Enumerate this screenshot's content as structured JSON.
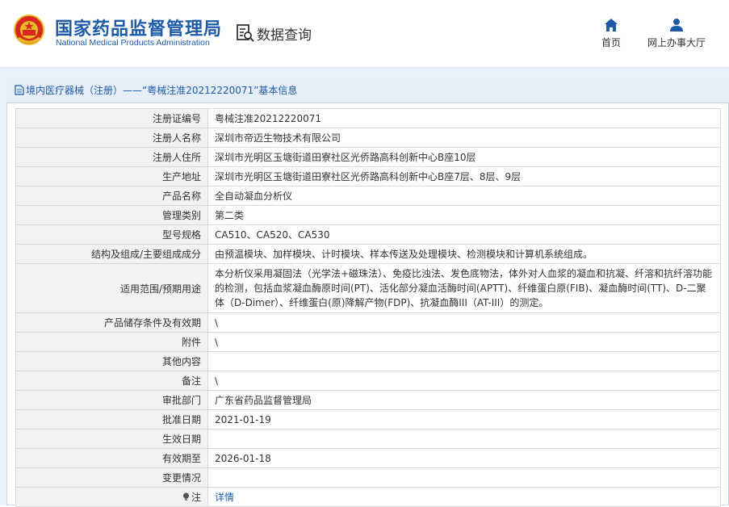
{
  "header": {
    "org_cn": "国家药品监督管理局",
    "org_en": "National Medical Products Administration",
    "query_label": "数据查询",
    "nav": [
      {
        "label": "首页",
        "icon": "home-icon"
      },
      {
        "label": "网上办事大厅",
        "icon": "user-icon"
      }
    ]
  },
  "breadcrumb": "境内医疗器械（注册）——“粤械注准20212220071”基本信息",
  "rows": [
    {
      "key": "注册证编号",
      "value": "粤械注准20212220071"
    },
    {
      "key": "注册人名称",
      "value": "深圳市帝迈生物技术有限公司"
    },
    {
      "key": "注册人住所",
      "value": "深圳市光明区玉塘街道田寮社区光侨路高科创新中心B座10层"
    },
    {
      "key": "生产地址",
      "value": "深圳市光明区玉塘街道田寮社区光侨路高科创新中心B座7层、8层、9层"
    },
    {
      "key": "产品名称",
      "value": "全自动凝血分析仪"
    },
    {
      "key": "管理类别",
      "value": "第二类"
    },
    {
      "key": "型号规格",
      "value": "CA510、CA520、CA530"
    },
    {
      "key": "结构及组成/主要组成成分",
      "value": "由预温模块、加样模块、计时模块、样本传送及处理模块、检测模块和计算机系统组成。"
    },
    {
      "key": "适用范围/预期用途",
      "value": "本分析仪采用凝固法（光学法+磁珠法）、免疫比浊法、发色底物法，体外对人血浆的凝血和抗凝、纤溶和抗纤溶功能的检测，包括血浆凝血酶原时间(PT)、活化部分凝血活酶时间(APTT)、纤维蛋白原(FIB)、凝血酶时间(TT)、D-二聚体（D-Dimer）、纤维蛋白(原)降解产物(FDP)、抗凝血酶III（AT-III）的测定。"
    },
    {
      "key": "产品储存条件及有效期",
      "value": "\\"
    },
    {
      "key": "附件",
      "value": "\\"
    },
    {
      "key": "其他内容",
      "value": ""
    },
    {
      "key": "备注",
      "value": "\\"
    },
    {
      "key": "审批部门",
      "value": "广东省药品监督管理局"
    },
    {
      "key": "批准日期",
      "value": "2021-01-19"
    },
    {
      "key": "生效日期",
      "value": ""
    },
    {
      "key": "有效期至",
      "value": "2026-01-18"
    },
    {
      "key": "变更情况",
      "value": ""
    }
  ],
  "note_row": {
    "key": "注",
    "link": "详情",
    "icon": "lightbulb-icon"
  }
}
